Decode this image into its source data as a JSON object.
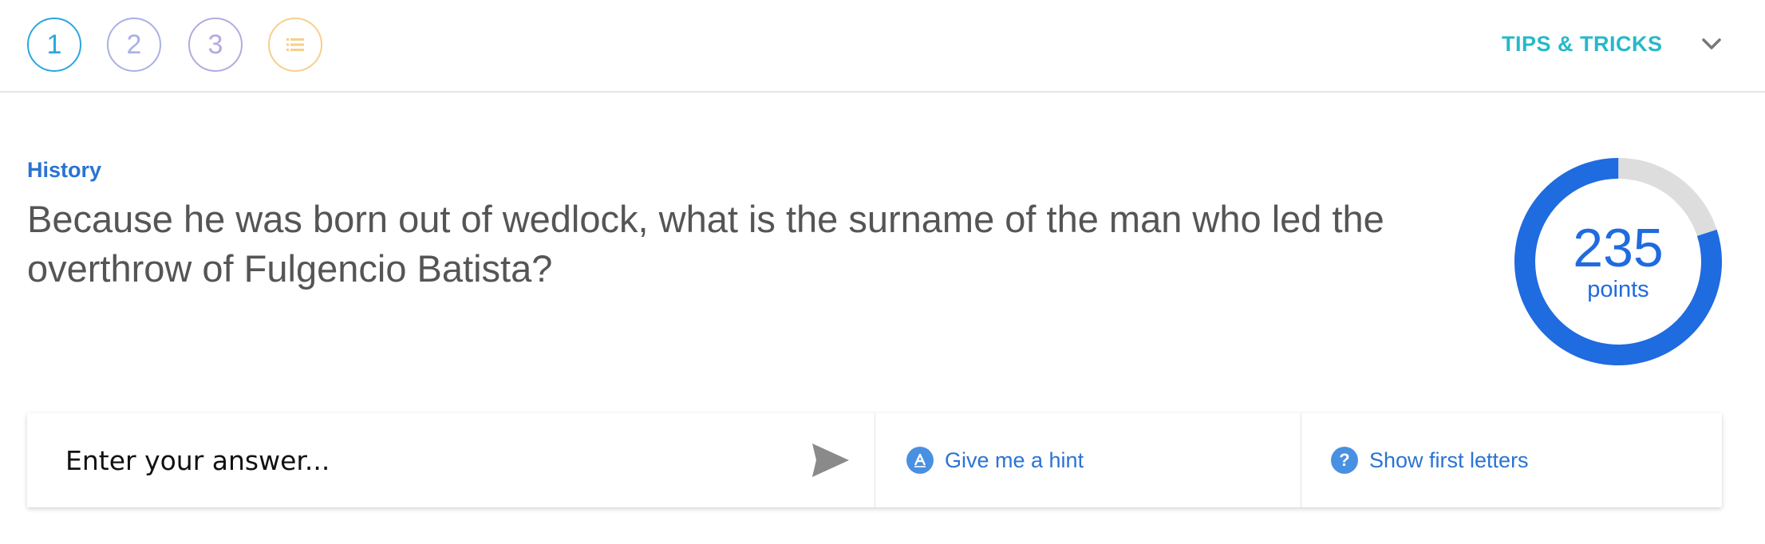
{
  "steps": [
    {
      "label": "1",
      "color": "#29a7e1"
    },
    {
      "label": "2",
      "color": "#a9b1e4"
    },
    {
      "label": "3",
      "color": "#b6a9e0"
    },
    {
      "icon": "list-icon",
      "color": "#f6cf8c"
    }
  ],
  "header": {
    "tips_label": "TIPS & TRICKS",
    "tips_color": "#25b9c9",
    "toggle_icon": "chevron-down-icon"
  },
  "question": {
    "category": "History",
    "text": "Because he was born out of wedlock, what is the surname of the man who led the overthrow of Fulgencio Batista?"
  },
  "score": {
    "value": "235",
    "label": "points",
    "progress_fraction": 0.8,
    "ring_color": "#1f6be0",
    "track_color": "#dddddd"
  },
  "answer": {
    "placeholder": "Enter your answer...",
    "send_icon": "send-icon"
  },
  "actions": {
    "hint_label": "Give me a hint",
    "hint_icon": "hint-icon",
    "letters_label": "Show first letters",
    "letters_icon": "question-icon"
  }
}
